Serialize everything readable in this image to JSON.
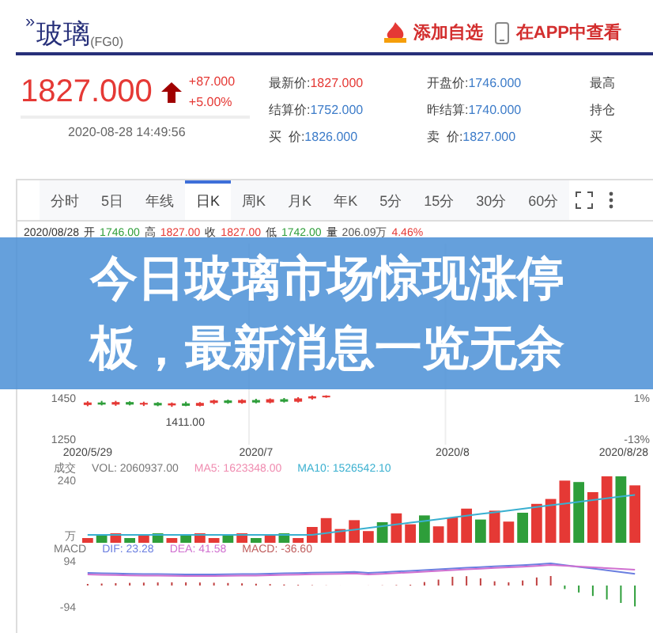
{
  "header": {
    "title_mark": "»",
    "title": "玻璃",
    "code": "(FG0)",
    "actions": [
      {
        "kind": "favorite",
        "label": "添加自选"
      },
      {
        "kind": "app",
        "label": "在APP中查看"
      }
    ]
  },
  "quote": {
    "price": "1827.000",
    "up": true,
    "change": "+87.000",
    "change_pct": "+5.00%",
    "time": "2020-08-28 14:49:56",
    "columns": [
      [
        {
          "label": "最新价:",
          "value": "1827.000",
          "kind": "up"
        },
        {
          "label": "结算价:",
          "value": "1752.000",
          "kind": "plain"
        },
        {
          "label": "买  价:",
          "value": "1826.000",
          "kind": "plain"
        }
      ],
      [
        {
          "label": "开盘价:",
          "value": "1746.000",
          "kind": "plain"
        },
        {
          "label": "昨结算:",
          "value": "1740.000",
          "kind": "plain"
        },
        {
          "label": "卖  价:",
          "value": "1827.000",
          "kind": "plain"
        }
      ],
      [
        {
          "label": "最高"
        },
        {
          "label": "持仓"
        },
        {
          "label": "买"
        }
      ]
    ]
  },
  "tabs": [
    {
      "label": "分时",
      "selected": false
    },
    {
      "label": "5日",
      "selected": false
    },
    {
      "label": "年线",
      "selected": false
    },
    {
      "label": "日K",
      "selected": true
    },
    {
      "label": "周K",
      "selected": false
    },
    {
      "label": "月K",
      "selected": false
    },
    {
      "label": "年K",
      "selected": false
    },
    {
      "label": "5分",
      "selected": false
    },
    {
      "label": "15分",
      "selected": false
    },
    {
      "label": "30分",
      "selected": false
    },
    {
      "label": "60分",
      "selected": false
    }
  ],
  "chart": {
    "date": "2020/08/28",
    "stats": [
      {
        "label": "开",
        "value": "1746.00",
        "kind": "down"
      },
      {
        "label": "高",
        "value": "1827.00",
        "kind": "up"
      },
      {
        "label": "收",
        "value": "1827.00",
        "kind": "up"
      },
      {
        "label": "低",
        "value": "1742.00",
        "kind": "down"
      },
      {
        "label": "量",
        "value": "206.09万",
        "kind": "plain"
      },
      {
        "value": "4.46%",
        "kind": "up"
      }
    ],
    "chart_data": {
      "type": "candlestick",
      "categories": [
        "2020/5/29",
        null,
        null,
        null,
        null,
        null,
        null,
        null,
        null,
        null,
        null,
        null,
        "2020/7",
        null,
        null,
        null,
        null,
        null,
        null,
        null,
        null,
        null,
        null,
        null,
        null,
        null,
        "2020/8",
        null,
        null,
        null,
        null,
        null,
        null,
        null,
        null,
        null,
        null,
        null,
        null,
        "2020/8/28"
      ],
      "ohlc": [
        [
          1420,
          1438,
          1414,
          1432
        ],
        [
          1432,
          1440,
          1418,
          1422
        ],
        [
          1422,
          1440,
          1416,
          1434
        ],
        [
          1434,
          1438,
          1418,
          1422
        ],
        [
          1422,
          1436,
          1415,
          1430
        ],
        [
          1430,
          1434,
          1414,
          1418
        ],
        [
          1418,
          1432,
          1411,
          1428
        ],
        [
          1428,
          1436,
          1414,
          1416
        ],
        [
          1416,
          1434,
          1413,
          1430
        ],
        [
          1430,
          1446,
          1424,
          1442
        ],
        [
          1442,
          1446,
          1426,
          1430
        ],
        [
          1430,
          1448,
          1426,
          1444
        ],
        [
          1444,
          1450,
          1428,
          1432
        ],
        [
          1432,
          1452,
          1428,
          1448
        ],
        [
          1448,
          1454,
          1432,
          1436
        ],
        [
          1436,
          1458,
          1432,
          1452
        ],
        [
          1452,
          1466,
          1446,
          1462
        ],
        [
          1462,
          1467,
          1455,
          1465
        ],
        null,
        null,
        null,
        null,
        null,
        null,
        null,
        null,
        null,
        null,
        null,
        null,
        null,
        null,
        null,
        null,
        null,
        null,
        null,
        null,
        null,
        null
      ],
      "ylim": [
        1227,
        2204
      ],
      "yticks": [
        {
          "value": 1450,
          "label": "1450"
        },
        {
          "value": 1250,
          "label": "1250"
        }
      ]
    },
    "pct_labels": [
      "1%",
      "-13%"
    ],
    "low_marker": "1411.00",
    "volume": {
      "title": "成交",
      "legend": [
        {
          "label": "VOL: 2060937.00",
          "color": "#777777"
        },
        {
          "label": "MA5: 1623348.00",
          "color": "#f08cb0"
        },
        {
          "label": "MA10: 1526542.10",
          "color": "#3ab0d0"
        }
      ],
      "y_labels": [
        "240",
        "万"
      ]
    },
    "macd": {
      "title": "MACD",
      "legend": [
        {
          "label": "DIF: 23.28",
          "color": "#6b7fe0"
        },
        {
          "label": "DEA: 41.58",
          "color": "#d070d0"
        },
        {
          "label": "MACD: -36.60",
          "color": "#c06060"
        }
      ],
      "y_labels": [
        "94",
        "-94"
      ]
    }
  },
  "headline": "今日玻璃市场惊现涨停板，最新消息一览无余"
}
